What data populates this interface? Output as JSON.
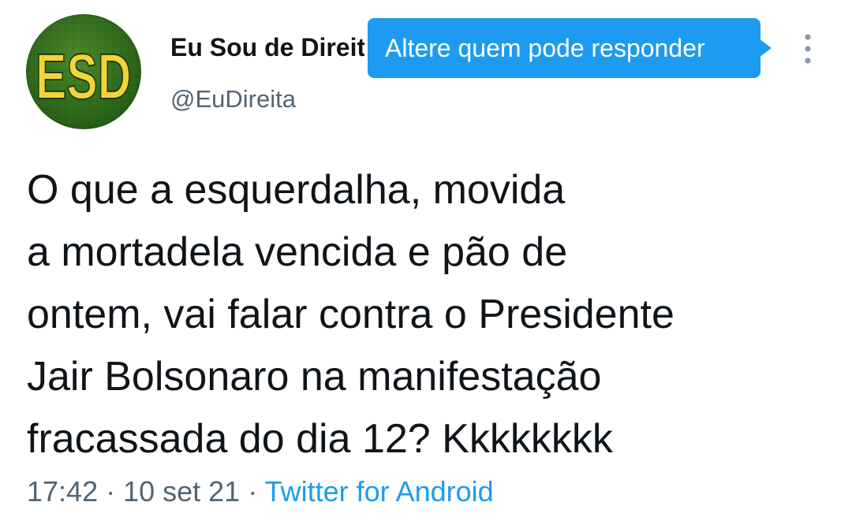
{
  "author": {
    "display_name": "Eu Sou de Direita",
    "handle": "@EuDireita",
    "avatar_text": "ESD",
    "avatar_colors": {
      "background": "#2f6a1c",
      "letters": "#f2d43a"
    }
  },
  "tooltip": {
    "text": "Altere quem pode responder",
    "color": "#1d9bf0"
  },
  "menu": {
    "icon": "more-vertical-icon"
  },
  "tweet": {
    "text": "O que a esquerdalha, movida\na mortadela vencida e pão de\nontem, vai falar contra o Presidente\nJair Bolsonaro na manifestação\nfracassada do dia 12? Kkkkkkkk"
  },
  "meta": {
    "time": "17:42",
    "separator": " · ",
    "date": "10 set 21",
    "source": "Twitter for Android",
    "source_color": "#1d9bf0"
  }
}
